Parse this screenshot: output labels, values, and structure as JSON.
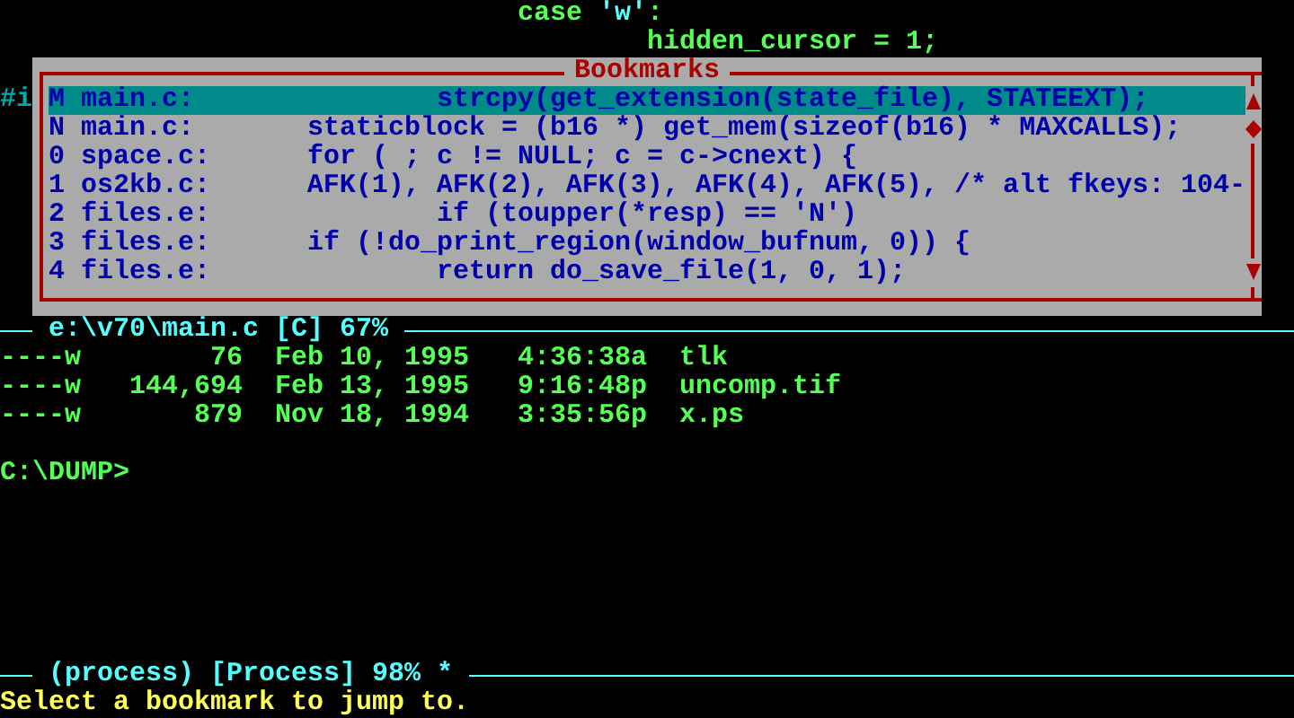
{
  "editor": {
    "lines": [
      {
        "segments": [
          {
            "text": "case ",
            "kind": "code"
          },
          {
            "text": "'w'",
            "kind": "char"
          },
          {
            "text": ":",
            "kind": "code"
          }
        ]
      },
      {
        "segments": [
          {
            "text": "hidden_cursor = 1;",
            "kind": "code"
          }
        ]
      }
    ],
    "background_text": "#i"
  },
  "bookmarks_dialog": {
    "title": "Bookmarks",
    "items": [
      {
        "key": "M",
        "file": "main.c:",
        "line": "        strcpy(get_extension(state_file), STATEEXT);",
        "selected": true
      },
      {
        "key": "N",
        "file": "main.c:",
        "line": "staticblock = (b16 *) get_mem(sizeof(b16) * MAXCALLS);",
        "selected": false
      },
      {
        "key": "0",
        "file": "space.c:",
        "line": "for ( ; c != NULL; c = c->cnext) {",
        "selected": false
      },
      {
        "key": "1",
        "file": "os2kb.c:",
        "line": "AFK(1), AFK(2), AFK(3), AFK(4), AFK(5), /* alt fkeys: 104-",
        "selected": false
      },
      {
        "key": "2",
        "file": "files.e:",
        "line": "        if (toupper(*resp) == 'N')",
        "selected": false
      },
      {
        "key": "3",
        "file": "files.e:",
        "line": "if (!do_print_region(window_bufnum, 0)) {",
        "selected": false
      },
      {
        "key": "4",
        "file": "files.e:",
        "line": "        return do_save_file(1, 0, 1);",
        "selected": false
      }
    ]
  },
  "mode_line": {
    "text": "e:\\v70\\main.c [C] 67%"
  },
  "listing": [
    {
      "permissions": "----w",
      "size": "76",
      "date": "Feb 10, 1995",
      "time": "4:36:38a",
      "name": "tlk"
    },
    {
      "permissions": "----w",
      "size": "144,694",
      "date": "Feb 13, 1995",
      "time": "9:16:48p",
      "name": "uncomp.tif"
    },
    {
      "permissions": "----w",
      "size": "879",
      "date": "Nov 18, 1994",
      "time": "3:35:56p",
      "name": "x.ps"
    }
  ],
  "prompt": "C:\\DUMP>",
  "process_mode_line": {
    "text": "(process) [Process] 98% *"
  },
  "echo_area": "Select a bookmark to jump to."
}
